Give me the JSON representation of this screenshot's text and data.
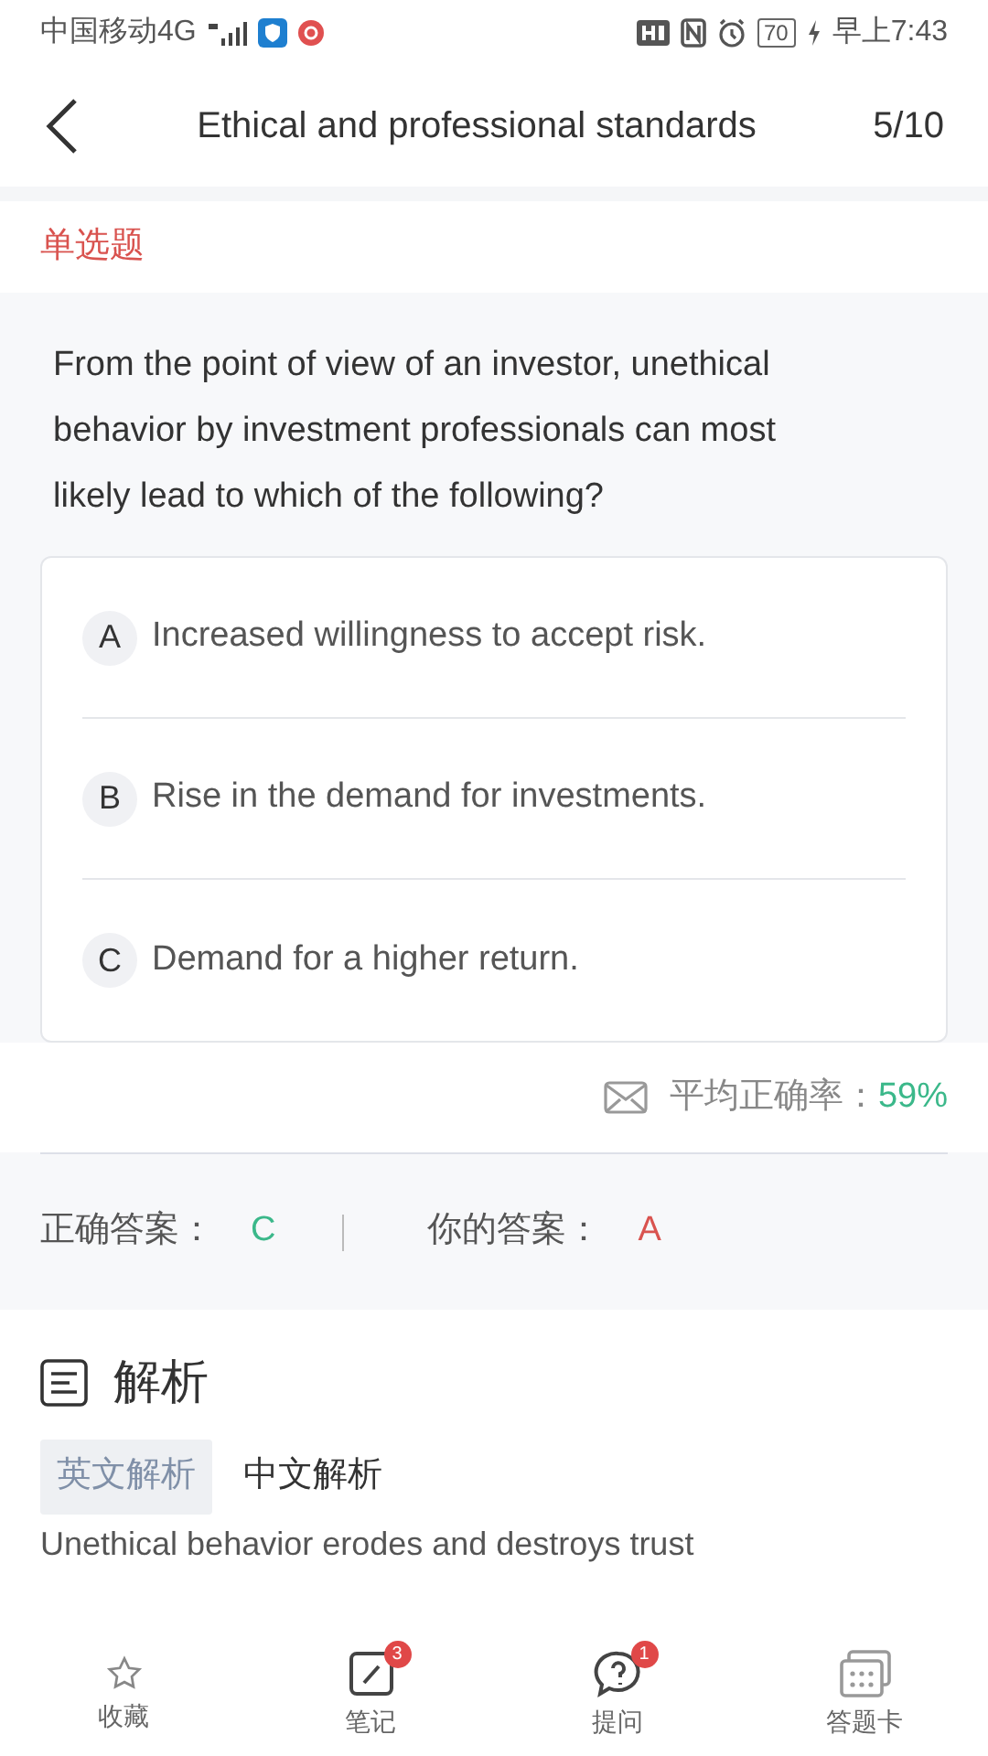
{
  "status_bar": {
    "carrier": "中国移动4G",
    "battery": "70",
    "time": "早上7:43"
  },
  "header": {
    "title": "Ethical and professional standards",
    "progress": "5/10"
  },
  "question_type": "单选题",
  "question": "From the point of view of an investor, unethical behavior by investment professionals can most likely lead to which of the following?",
  "options": [
    {
      "letter": "A",
      "text": "Increased willingness to accept risk."
    },
    {
      "letter": "B",
      "text": "Rise in the demand for investments."
    },
    {
      "letter": "C",
      "text": "Demand for a higher return."
    }
  ],
  "average": {
    "label": "平均正确率：",
    "value": "59%"
  },
  "answers": {
    "correct_label": "正确答案：",
    "correct": "C",
    "yours_label": "你的答案：",
    "yours": "A"
  },
  "analysis": {
    "title": "解析",
    "tabs": [
      {
        "label": "英文解析",
        "selected": true
      },
      {
        "label": "中文解析",
        "selected": false
      }
    ],
    "text": "Unethical behavior erodes and destroys trust"
  },
  "bottom_nav": [
    {
      "kind": "star",
      "label": "收藏"
    },
    {
      "kind": "note",
      "label": "笔记",
      "badge": "3"
    },
    {
      "kind": "ask",
      "label": "提问",
      "badge": "1"
    },
    {
      "kind": "card",
      "label": "答题卡"
    }
  ]
}
